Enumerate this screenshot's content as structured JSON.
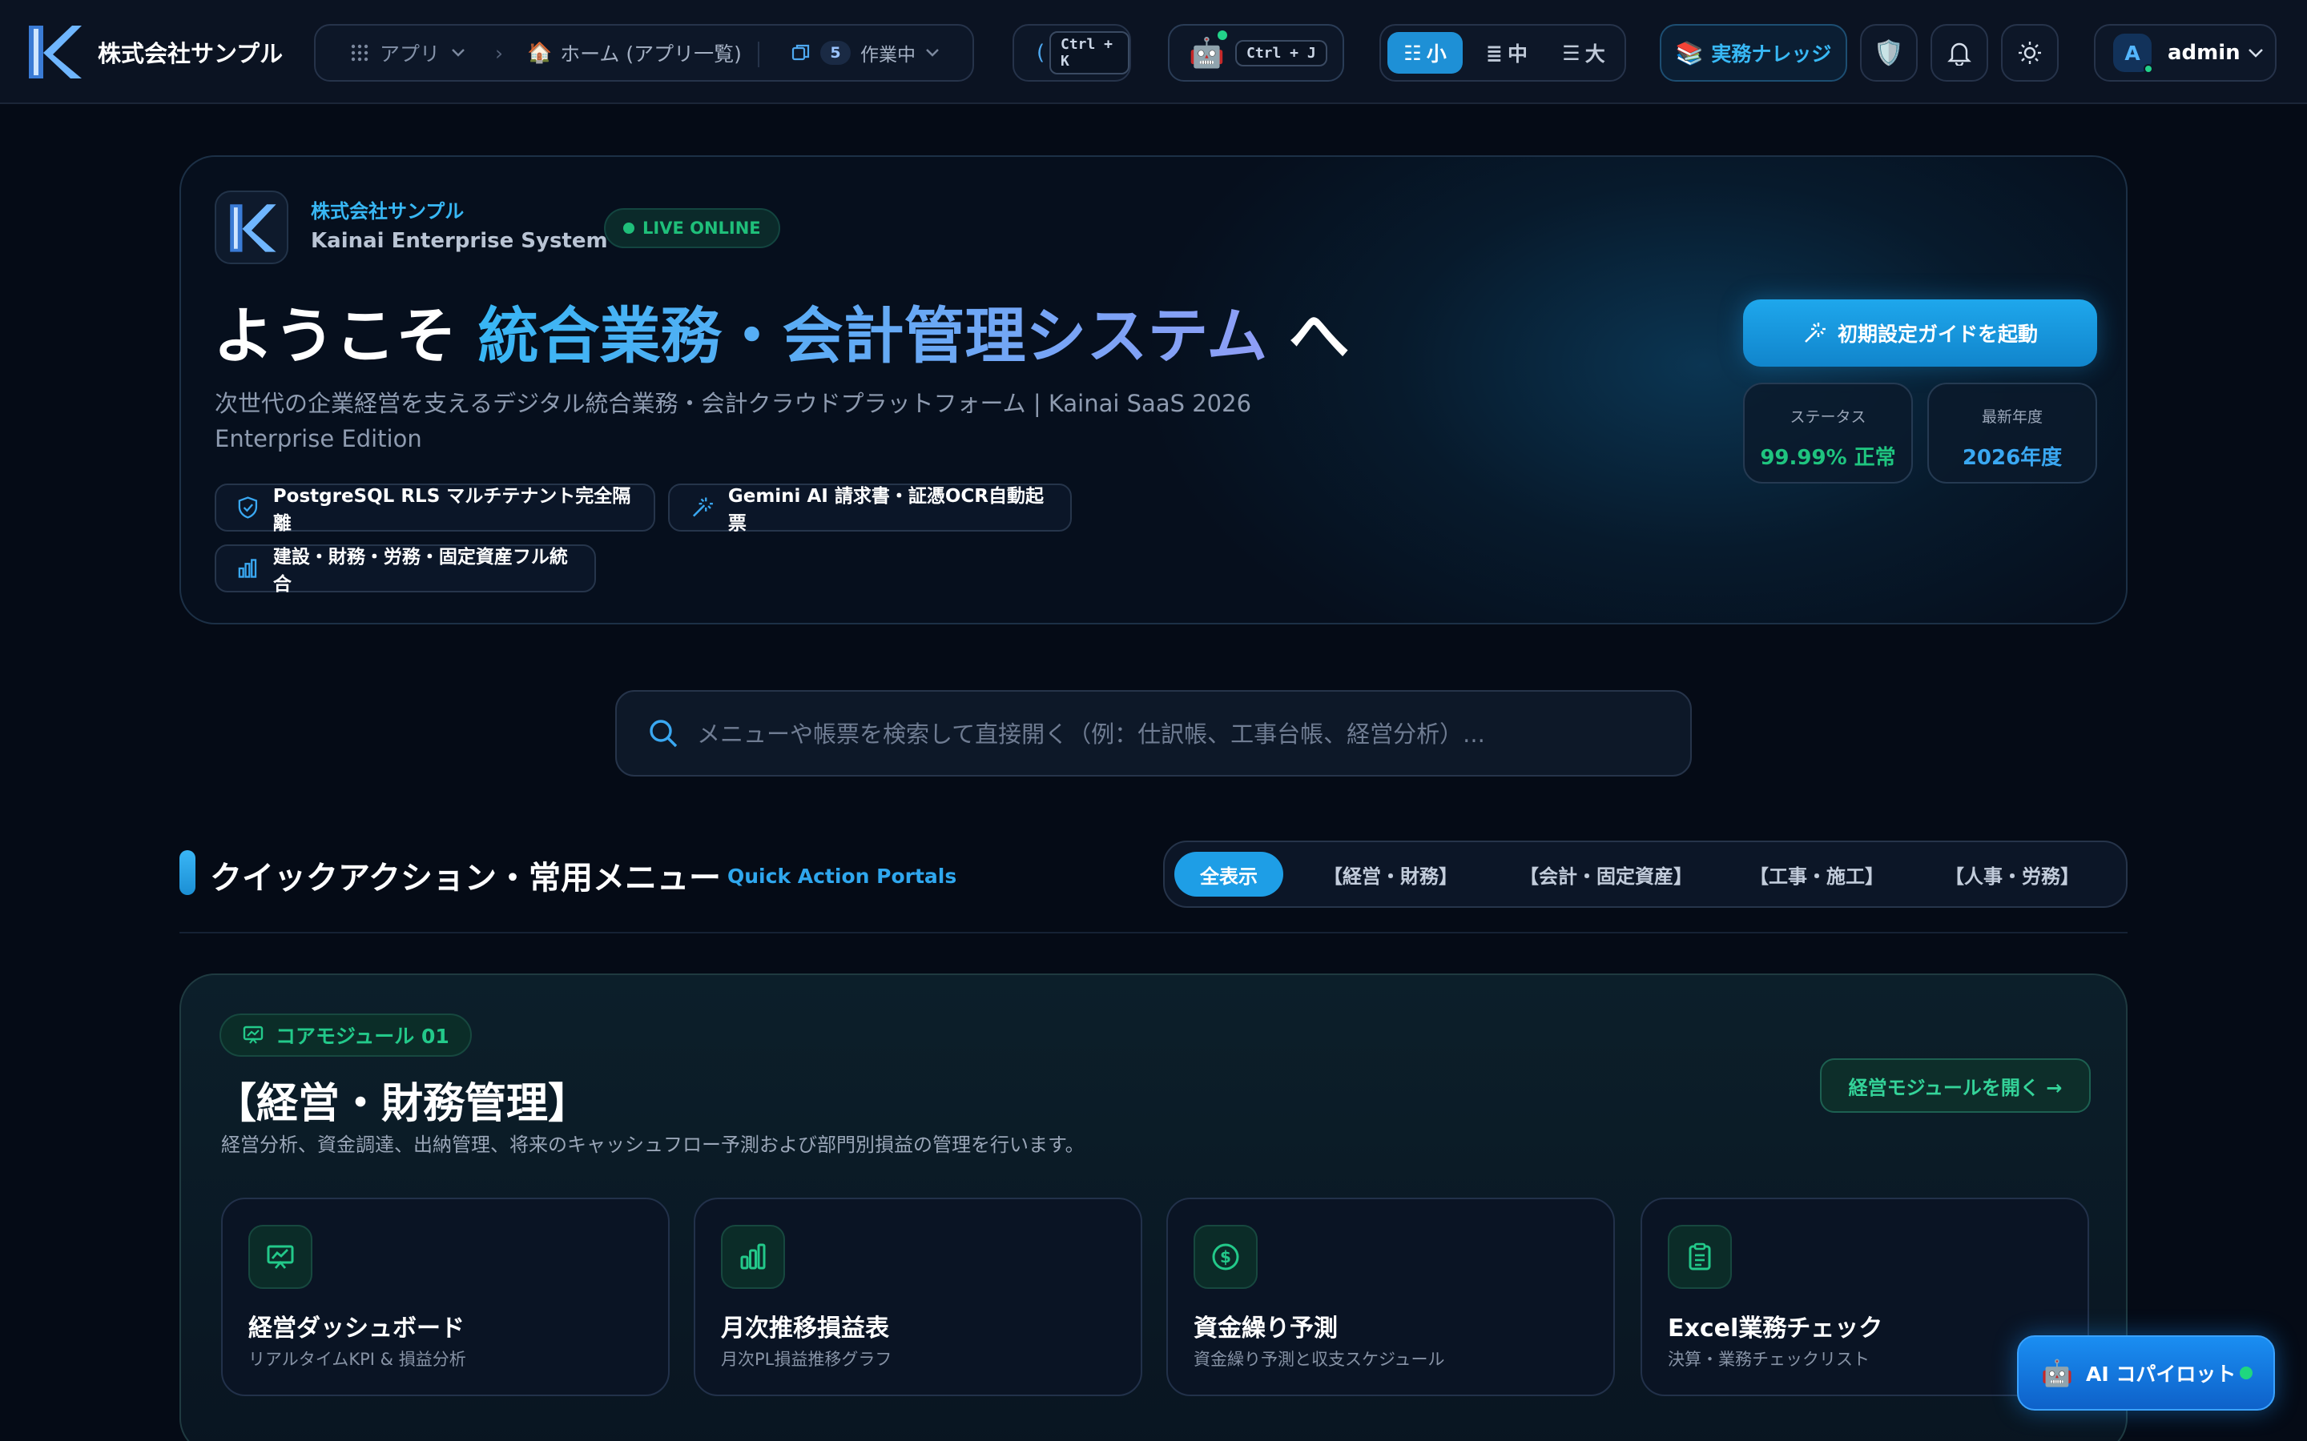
{
  "header": {
    "brand": "株式会社サンプル",
    "nav_apps": "アプリ",
    "nav_home": "ホーム (アプリ一覧)",
    "work_count": "5",
    "work_label": "作業中",
    "search_shortcut": "Ctrl + K",
    "ai_shortcut": "Ctrl + J",
    "size_small": "小",
    "size_medium": "中",
    "size_large": "大",
    "knowledge": "実務ナレッジ",
    "user_initial": "A",
    "user_name": "admin"
  },
  "hero": {
    "company": "株式会社サンプル",
    "system": "Kainai Enterprise System",
    "live_badge": "LIVE ONLINE",
    "title_pre": "ようこそ ",
    "title_accent": "統合業務・会計管理システム",
    "title_post": " へ",
    "subtitle": "次世代の企業経営を支えるデジタル統合業務・会計クラウドプラットフォーム | Kainai SaaS 2026 Enterprise Edition",
    "features": [
      "PostgreSQL RLS マルチテナント完全隔離",
      "Gemini AI 請求書・証憑OCR自動起票",
      "建設・財務・労務・固定資産フル統合"
    ],
    "cta": "初期設定ガイドを起動",
    "stats": [
      {
        "label": "ステータス",
        "value": "99.99% 正常",
        "color": "#1fc47f"
      },
      {
        "label": "最新年度",
        "value": "2026年度",
        "color": "#3aa8f2"
      }
    ]
  },
  "search": {
    "placeholder": "メニューや帳票を検索して直接開く（例：仕訳帳、工事台帳、経営分析）..."
  },
  "quick_actions": {
    "title": "クイックアクション・常用メニュー",
    "subtitle": "Quick Action Portals",
    "tabs": [
      "全表示",
      "【経営・財務】",
      "【会計・固定資産】",
      "【工事・施工】",
      "【人事・労務】"
    ]
  },
  "module": {
    "tag": "コアモジュール 01",
    "title": "【経営・財務管理】",
    "description": "経営分析、資金調達、出納管理、将来のキャッシュフロー予測および部門別損益の管理を行います。",
    "open_button": "経営モジュールを開く →",
    "cards": [
      {
        "title": "経営ダッシュボード",
        "sub": "リアルタイムKPI & 損益分析",
        "icon": "presentation-chart-icon"
      },
      {
        "title": "月次推移損益表",
        "sub": "月次PL損益推移グラフ",
        "icon": "bar-chart-icon"
      },
      {
        "title": "資金繰り予測",
        "sub": "資金繰り予測と収支スケジュール",
        "icon": "dollar-circle-icon"
      },
      {
        "title": "Excel業務チェック",
        "sub": "決算・業務チェックリスト",
        "icon": "clipboard-check-icon"
      }
    ]
  },
  "copilot": {
    "label": "AI コパイロット"
  },
  "colors": {
    "accent": "#1e9ee6",
    "success": "#1fc47f",
    "background": "#050b16"
  }
}
